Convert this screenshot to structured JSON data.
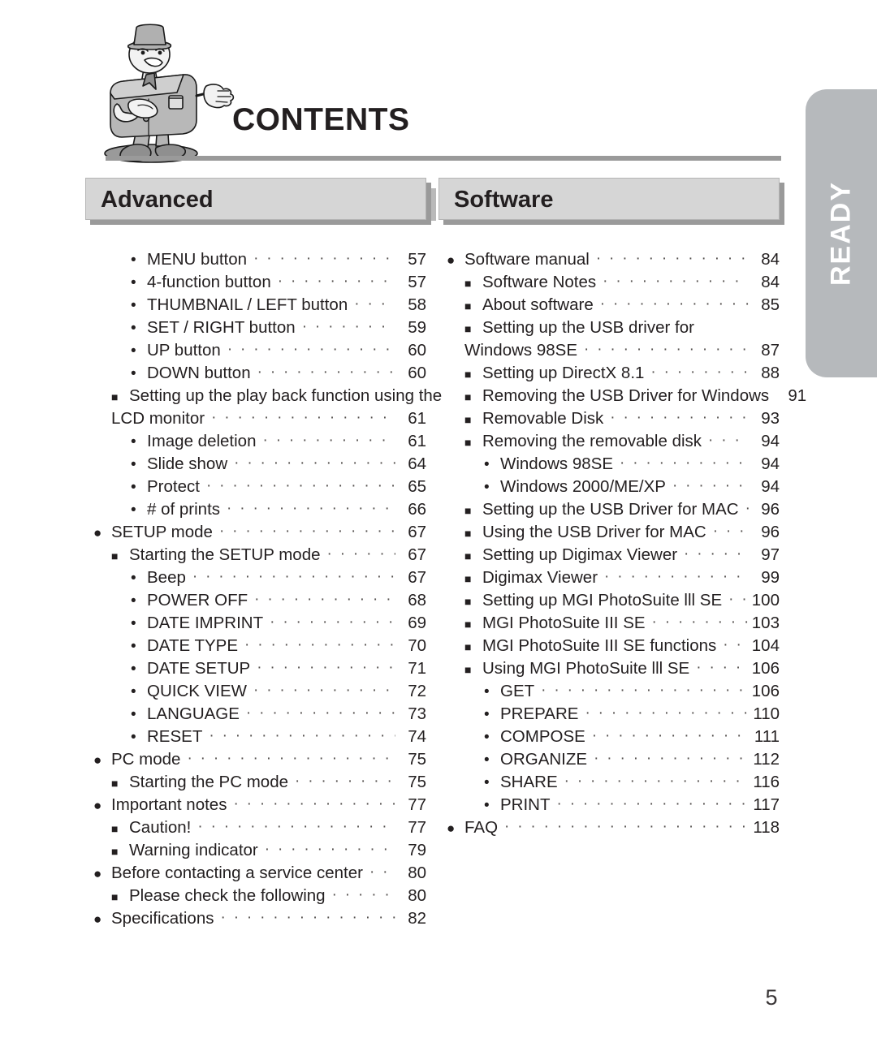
{
  "document": {
    "title": "CONTENTS",
    "page_number": "5",
    "side_tab_label": "READY"
  },
  "sections": [
    {
      "id": "advanced",
      "header": "Advanced",
      "entries": [
        {
          "level": 3,
          "bullet": "dot",
          "label": "MENU button",
          "page": "57"
        },
        {
          "level": 3,
          "bullet": "dot",
          "label": "4-function button",
          "page": "57"
        },
        {
          "level": 3,
          "bullet": "dot",
          "label": "THUMBNAIL / LEFT button",
          "page": "58"
        },
        {
          "level": 3,
          "bullet": "dot",
          "label": "SET / RIGHT button",
          "page": "59"
        },
        {
          "level": 3,
          "bullet": "dot",
          "label": "UP button",
          "page": "60"
        },
        {
          "level": 3,
          "bullet": "dot",
          "label": "DOWN button",
          "page": "60"
        },
        {
          "level": 2,
          "bullet": "square",
          "label": "Setting up the play back function using the",
          "page": "",
          "wrap": true
        },
        {
          "level": 0,
          "bullet": "none",
          "label": "LCD monitor",
          "page": "61"
        },
        {
          "level": 3,
          "bullet": "dot",
          "label": "Image deletion",
          "page": "61"
        },
        {
          "level": 3,
          "bullet": "dot",
          "label": "Slide show",
          "page": "64"
        },
        {
          "level": 3,
          "bullet": "dot",
          "label": "Protect",
          "page": "65"
        },
        {
          "level": 3,
          "bullet": "dot",
          "label": "# of prints",
          "page": "66"
        },
        {
          "level": 1,
          "bullet": "circle",
          "label": "SETUP mode",
          "page": "67"
        },
        {
          "level": 2,
          "bullet": "square",
          "label": "Starting the SETUP mode",
          "page": "67"
        },
        {
          "level": 3,
          "bullet": "dot",
          "label": "Beep",
          "page": "67"
        },
        {
          "level": 3,
          "bullet": "dot",
          "label": "POWER OFF",
          "page": "68"
        },
        {
          "level": 3,
          "bullet": "dot",
          "label": "DATE IMPRINT",
          "page": "69"
        },
        {
          "level": 3,
          "bullet": "dot",
          "label": "DATE TYPE",
          "page": "70"
        },
        {
          "level": 3,
          "bullet": "dot",
          "label": "DATE SETUP",
          "page": "71"
        },
        {
          "level": 3,
          "bullet": "dot",
          "label": "QUICK VIEW",
          "page": "72"
        },
        {
          "level": 3,
          "bullet": "dot",
          "label": "LANGUAGE",
          "page": "73"
        },
        {
          "level": 3,
          "bullet": "dot",
          "label": "RESET",
          "page": "74"
        },
        {
          "level": 1,
          "bullet": "circle",
          "label": "PC mode",
          "page": "75"
        },
        {
          "level": 2,
          "bullet": "square",
          "label": "Starting the PC mode",
          "page": "75"
        },
        {
          "level": 1,
          "bullet": "circle",
          "label": "Important notes",
          "page": "77"
        },
        {
          "level": 2,
          "bullet": "square",
          "label": "Caution!",
          "page": "77"
        },
        {
          "level": 2,
          "bullet": "square",
          "label": "Warning indicator",
          "page": "79"
        },
        {
          "level": 1,
          "bullet": "circle",
          "label": "Before contacting a service center",
          "page": "80"
        },
        {
          "level": 2,
          "bullet": "square",
          "label": "Please check the following",
          "page": "80"
        },
        {
          "level": 1,
          "bullet": "circle",
          "label": "Specifications",
          "page": "82"
        }
      ]
    },
    {
      "id": "software",
      "header": "Software",
      "entries": [
        {
          "level": 1,
          "bullet": "circle",
          "label": "Software manual",
          "page": "84"
        },
        {
          "level": 2,
          "bullet": "square",
          "label": "Software Notes",
          "page": "84"
        },
        {
          "level": 2,
          "bullet": "square",
          "label": "About software",
          "page": "85"
        },
        {
          "level": 2,
          "bullet": "square",
          "label": "Setting up the USB driver for",
          "page": "",
          "wrap": true
        },
        {
          "level": 0,
          "bullet": "none",
          "label": "Windows 98SE",
          "page": "87"
        },
        {
          "level": 2,
          "bullet": "square",
          "label": "Setting up DirectX 8.1",
          "page": "88"
        },
        {
          "level": 2,
          "bullet": "square",
          "label": "Removing the USB Driver for Windows",
          "page": "91"
        },
        {
          "level": 2,
          "bullet": "square",
          "label": "Removable Disk",
          "page": "93"
        },
        {
          "level": 2,
          "bullet": "square",
          "label": "Removing the removable disk",
          "page": "94"
        },
        {
          "level": 3,
          "bullet": "dot",
          "label": "Windows 98SE",
          "page": "94"
        },
        {
          "level": 3,
          "bullet": "dot",
          "label": "Windows 2000/ME/XP",
          "page": "94"
        },
        {
          "level": 2,
          "bullet": "square",
          "label": "Setting up the USB Driver for MAC",
          "page": "96"
        },
        {
          "level": 2,
          "bullet": "square",
          "label": "Using the USB Driver for MAC",
          "page": "96"
        },
        {
          "level": 2,
          "bullet": "square",
          "label": "Setting up Digimax Viewer",
          "page": "97"
        },
        {
          "level": 2,
          "bullet": "square",
          "label": "Digimax Viewer",
          "page": "99"
        },
        {
          "level": 2,
          "bullet": "square",
          "label": "Setting up MGI PhotoSuite lll SE",
          "page": "100"
        },
        {
          "level": 2,
          "bullet": "square",
          "label": "MGI PhotoSuite III SE",
          "page": "103"
        },
        {
          "level": 2,
          "bullet": "square",
          "label": "MGI PhotoSuite III SE functions",
          "page": "104"
        },
        {
          "level": 2,
          "bullet": "square",
          "label": "Using MGI PhotoSuite lll SE",
          "page": "106"
        },
        {
          "level": 3,
          "bullet": "dot",
          "label": "GET",
          "page": "106"
        },
        {
          "level": 3,
          "bullet": "dot",
          "label": "PREPARE",
          "page": "110"
        },
        {
          "level": 3,
          "bullet": "dot",
          "label": "COMPOSE",
          "page": "111"
        },
        {
          "level": 3,
          "bullet": "dot",
          "label": "ORGANIZE",
          "page": "112"
        },
        {
          "level": 3,
          "bullet": "dot",
          "label": "SHARE",
          "page": "116"
        },
        {
          "level": 3,
          "bullet": "dot",
          "label": "PRINT",
          "page": "117"
        },
        {
          "level": 1,
          "bullet": "circle",
          "label": "FAQ",
          "page": "118"
        }
      ]
    }
  ],
  "colors": {
    "ink": "#231f20",
    "bar_fill": "#d6d6d6",
    "bar_shadow": "#9a9a9a",
    "rule": "#9a9a9a",
    "tab_fill": "#b6b9bc",
    "tab_text": "#ffffff"
  },
  "icons": {
    "mascot": "camera-mascot-illustration",
    "bullet_circle": "filled-circle-bullet",
    "bullet_square": "filled-square-bullet",
    "bullet_dot": "small-dot-bullet"
  }
}
